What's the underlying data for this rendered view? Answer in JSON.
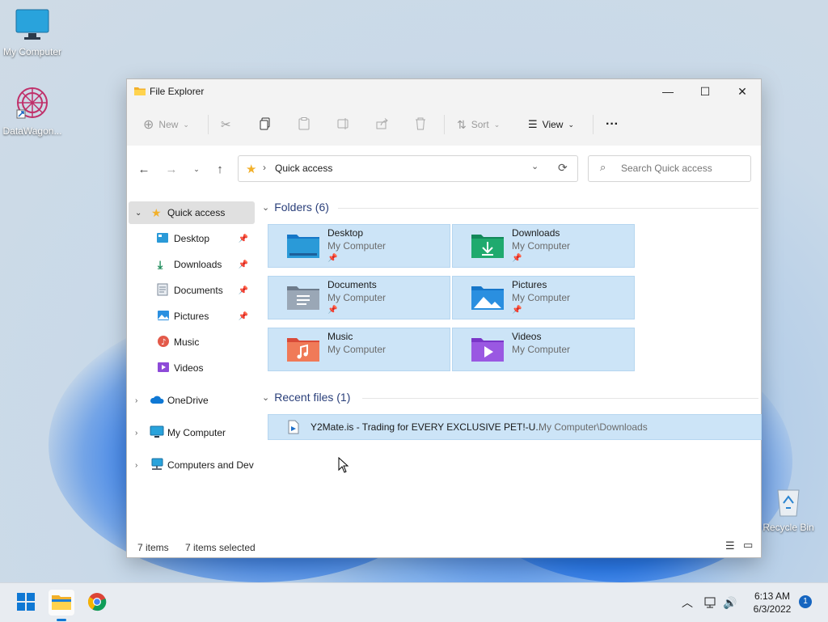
{
  "desktop": {
    "icons": [
      {
        "label": "My Computer",
        "icon": "monitor-icon"
      },
      {
        "label": "DataWagon...",
        "icon": "datawagon-app-icon"
      },
      {
        "label": "Recycle Bin",
        "icon": "recycle-bin-icon"
      }
    ]
  },
  "window": {
    "title": "File Explorer",
    "controls": {
      "minimize": "—",
      "maximize": "☐",
      "close": "✕"
    }
  },
  "commandbar": {
    "new_label": "New",
    "sort_label": "Sort",
    "view_label": "View",
    "more_label": "···"
  },
  "nav": {
    "address": "Quick access",
    "search_placeholder": "Search Quick access"
  },
  "sidebar": {
    "items": [
      {
        "label": "Quick access",
        "icon": "star-icon",
        "pinned": false
      },
      {
        "label": "Desktop",
        "icon": "desktop-folder-icon",
        "pinned": true
      },
      {
        "label": "Downloads",
        "icon": "downloads-icon",
        "pinned": true
      },
      {
        "label": "Documents",
        "icon": "documents-icon",
        "pinned": true
      },
      {
        "label": "Pictures",
        "icon": "pictures-icon",
        "pinned": true
      },
      {
        "label": "Music",
        "icon": "music-icon",
        "pinned": false
      },
      {
        "label": "Videos",
        "icon": "videos-icon",
        "pinned": false
      },
      {
        "label": "OneDrive",
        "icon": "cloud-icon",
        "pinned": false
      },
      {
        "label": "My Computer",
        "icon": "monitor-icon",
        "pinned": false
      },
      {
        "label": "Computers and Dev",
        "icon": "network-icon",
        "pinned": false
      }
    ]
  },
  "folders": {
    "header": "Folders (6)",
    "items": [
      {
        "name": "Desktop",
        "location": "My Computer",
        "pinned": true,
        "icon": "desktop-folder-icon"
      },
      {
        "name": "Downloads",
        "location": "My Computer",
        "pinned": true,
        "icon": "downloads-folder-icon"
      },
      {
        "name": "Documents",
        "location": "My Computer",
        "pinned": true,
        "icon": "documents-folder-icon"
      },
      {
        "name": "Pictures",
        "location": "My Computer",
        "pinned": true,
        "icon": "pictures-folder-icon"
      },
      {
        "name": "Music",
        "location": "My Computer",
        "pinned": false,
        "icon": "music-folder-icon"
      },
      {
        "name": "Videos",
        "location": "My Computer",
        "pinned": false,
        "icon": "videos-folder-icon"
      }
    ]
  },
  "recent": {
    "header": "Recent files (1)",
    "items": [
      {
        "name": "Y2Mate.is - Trading for EVERY EXCLUSIVE PET!-U...",
        "path": "My Computer\\Downloads",
        "icon": "video-file-icon"
      }
    ]
  },
  "status": {
    "count": "7 items",
    "selected": "7 items selected"
  },
  "taskbar": {
    "time": "6:13 AM",
    "date": "6/3/2022",
    "notifications": "1"
  },
  "colors": {
    "selection": "#cce4f7",
    "accent": "#0067c0",
    "section_header": "#2a3f7a"
  }
}
